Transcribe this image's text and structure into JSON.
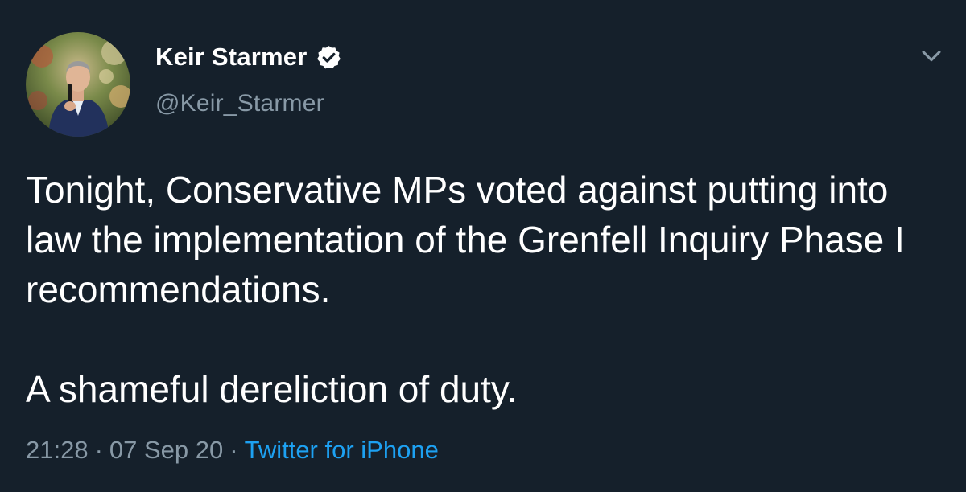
{
  "tweet": {
    "author": {
      "display_name": "Keir Starmer",
      "handle": "@Keir_Starmer",
      "verified": true
    },
    "text": {
      "paragraph_1": "Tonight, Conservative MPs voted against putting into law the implementation of the Grenfell Inquiry Phase I recommendations.",
      "paragraph_2": "A shameful dereliction of duty."
    },
    "meta": {
      "time": "21:28",
      "separator": "·",
      "date": "07 Sep 20",
      "source": "Twitter for iPhone"
    }
  },
  "icons": {
    "verified": "verified-badge-icon",
    "menu": "chevron-down-icon"
  },
  "colors": {
    "background": "#15202b",
    "primary_text": "#ffffff",
    "secondary_text": "#8899a6",
    "accent": "#1da1f2"
  }
}
